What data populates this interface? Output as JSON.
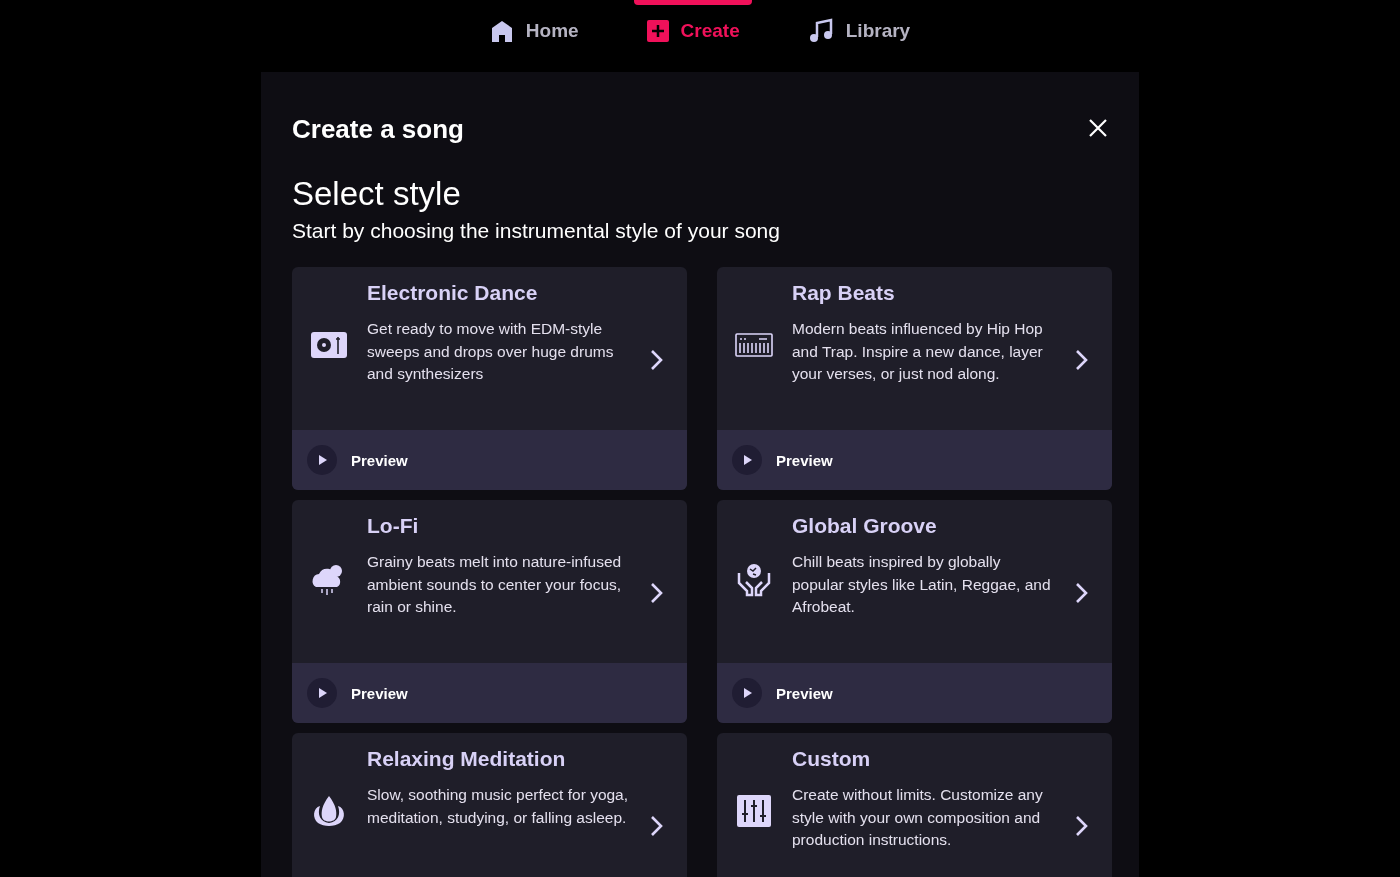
{
  "nav": [
    {
      "label": "Home",
      "selected": false
    },
    {
      "label": "Create",
      "selected": true
    },
    {
      "label": "Library",
      "selected": false
    }
  ],
  "dialog": {
    "title": "Create a song",
    "heading": "Select style",
    "subtitle": "Start by choosing the instrumental style of your song"
  },
  "styles": [
    {
      "name": "Electronic Dance",
      "description": "Get ready to move with EDM-style sweeps and drops over huge drums and synthesizers",
      "preview": "Preview"
    },
    {
      "name": "Rap Beats",
      "description": "Modern beats influenced by Hip Hop and Trap. Inspire a new dance, layer your verses, or just nod along.",
      "preview": "Preview"
    },
    {
      "name": "Lo-Fi",
      "description": "Grainy beats melt into nature-infused ambient sounds to center your focus, rain or shine.",
      "preview": "Preview"
    },
    {
      "name": "Global Groove",
      "description": "Chill beats inspired by globally popular styles like Latin, Reggae, and Afrobeat.",
      "preview": "Preview"
    },
    {
      "name": "Relaxing Meditation",
      "description": "Slow, soothing music perfect for yoga, meditation, studying, or falling asleep."
    },
    {
      "name": "Custom",
      "description": "Create without limits. Customize any style with your own composition and production instructions."
    }
  ]
}
